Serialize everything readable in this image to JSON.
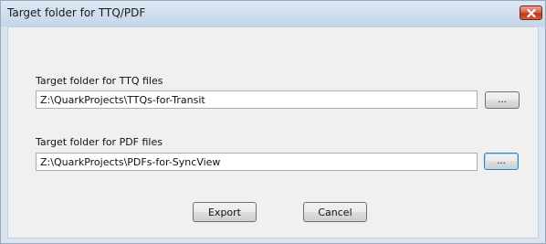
{
  "window": {
    "title": "Target folder for TTQ/PDF",
    "close_icon": "close-icon"
  },
  "ttq": {
    "label": "Target folder for TTQ files",
    "value": "Z:\\QuarkProjects\\TTQs-for-Transit",
    "browse_label": "..."
  },
  "pdf": {
    "label": "Target folder for PDF files",
    "value": "Z:\\QuarkProjects\\PDFs-for-SyncView",
    "browse_label": "..."
  },
  "buttons": {
    "export_label": "Export",
    "cancel_label": "Cancel"
  },
  "colors": {
    "titlebar": "#cfdeee",
    "close": "#c7462b",
    "panel": "#f0f0f0"
  }
}
